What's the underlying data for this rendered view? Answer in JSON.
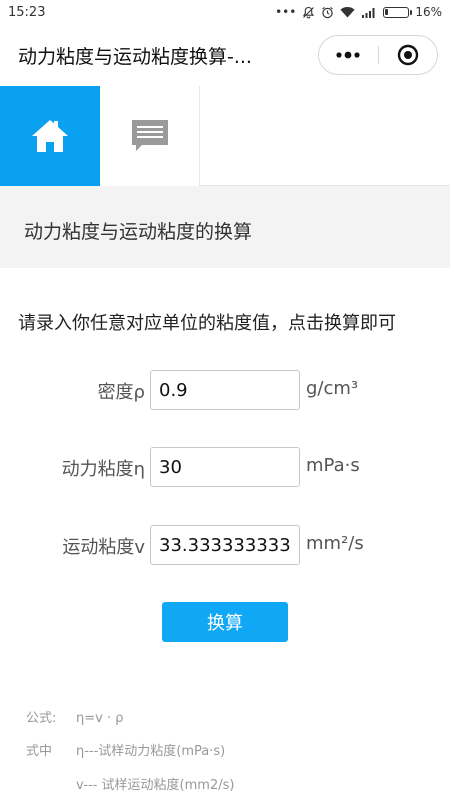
{
  "status_bar": {
    "time": "15:23",
    "battery": "16%",
    "battery_level": 0.16
  },
  "nav": {
    "title": "动力粘度与运动粘度换算-..."
  },
  "tabs": {
    "home_icon": "home-icon",
    "message_icon": "message-icon"
  },
  "section": {
    "title": "动力粘度与运动粘度的换算"
  },
  "instruction": "请录入你任意对应单位的粘度值，点击换算即可",
  "fields": {
    "density": {
      "label": "密度ρ",
      "value": "0.9",
      "unit": "g/cm³"
    },
    "dynamic": {
      "label": "动力粘度η",
      "value": "30",
      "unit": "mPa·s"
    },
    "kinematic": {
      "label": "运动粘度v",
      "value": "33.333333333333",
      "unit": "mm²/s"
    }
  },
  "convert_button": "换算",
  "formula": {
    "label": "公式:",
    "expr": "η=v · ρ",
    "where_label": "式中",
    "eta_desc": "η---试样动力粘度(mPa·s)",
    "v_desc": "v--- 试样运动粘度(mm2/s)"
  },
  "colors": {
    "accent": "#0aa2f0",
    "button": "#10a8f4"
  }
}
